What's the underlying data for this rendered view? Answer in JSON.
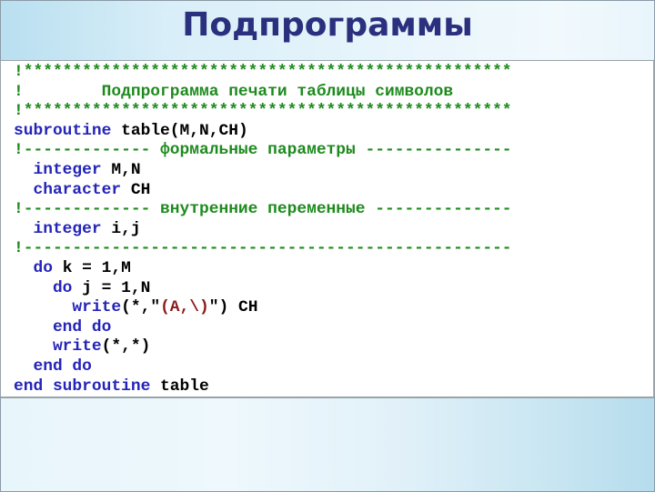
{
  "slide": {
    "title": "Подпрограммы",
    "colors": {
      "title": "#2a2f7e",
      "comment": "#1e8a1e",
      "keyword": "#2424b8",
      "text": "#000000",
      "string": "#8b1a1a"
    }
  },
  "code": {
    "language": "Fortran",
    "lines": [
      {
        "tokens": [
          {
            "type": "comment",
            "text": "!**************************************************"
          }
        ]
      },
      {
        "tokens": [
          {
            "type": "comment",
            "text": "!        Подпрограмма печати таблицы символов"
          }
        ]
      },
      {
        "tokens": [
          {
            "type": "comment",
            "text": "!**************************************************"
          }
        ]
      },
      {
        "tokens": [
          {
            "type": "keyword",
            "text": "subroutine"
          },
          {
            "type": "text",
            "text": " table(M,N,CH)"
          }
        ]
      },
      {
        "tokens": [
          {
            "type": "comment",
            "text": "!------------- формальные параметры ---------------"
          }
        ]
      },
      {
        "tokens": [
          {
            "type": "keyword",
            "text": "  integer"
          },
          {
            "type": "text",
            "text": " M,N"
          }
        ]
      },
      {
        "tokens": [
          {
            "type": "keyword",
            "text": "  character"
          },
          {
            "type": "text",
            "text": " CH"
          }
        ]
      },
      {
        "tokens": [
          {
            "type": "comment",
            "text": "!------------- внутренние переменные --------------"
          }
        ]
      },
      {
        "tokens": [
          {
            "type": "keyword",
            "text": "  integer"
          },
          {
            "type": "text",
            "text": " i,j"
          }
        ]
      },
      {
        "tokens": [
          {
            "type": "comment",
            "text": "!--------------------------------------------------"
          }
        ]
      },
      {
        "tokens": [
          {
            "type": "keyword",
            "text": "  do"
          },
          {
            "type": "text",
            "text": " k = 1,M"
          }
        ]
      },
      {
        "tokens": [
          {
            "type": "keyword",
            "text": "    do"
          },
          {
            "type": "text",
            "text": " j = 1,N"
          }
        ]
      },
      {
        "tokens": [
          {
            "type": "keyword",
            "text": "      write"
          },
          {
            "type": "text",
            "text": "(*,\""
          },
          {
            "type": "string",
            "text": "(A,\\)"
          },
          {
            "type": "text",
            "text": "\") CH"
          }
        ]
      },
      {
        "tokens": [
          {
            "type": "keyword",
            "text": "    end do"
          }
        ]
      },
      {
        "tokens": [
          {
            "type": "keyword",
            "text": "    write"
          },
          {
            "type": "text",
            "text": "(*,*)"
          }
        ]
      },
      {
        "tokens": [
          {
            "type": "keyword",
            "text": "  end do"
          }
        ]
      },
      {
        "tokens": [
          {
            "type": "keyword",
            "text": "end subroutine"
          },
          {
            "type": "text",
            "text": " table"
          }
        ]
      }
    ]
  }
}
